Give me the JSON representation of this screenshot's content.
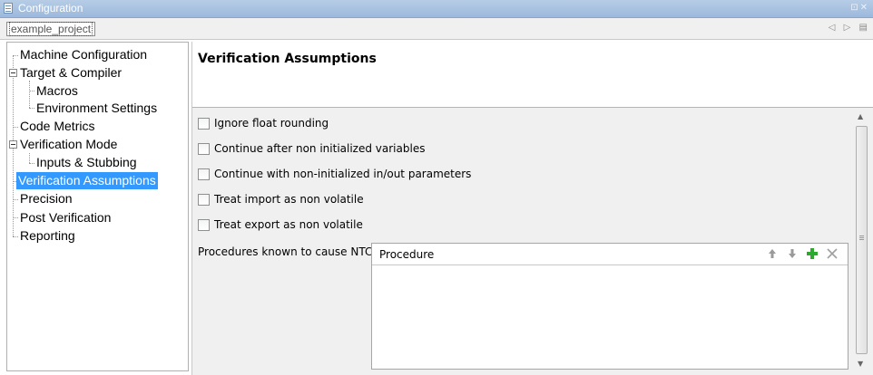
{
  "window": {
    "title": "Configuration",
    "controls": "⊡✕"
  },
  "project": {
    "name": "example_project",
    "nav_prev": "◁",
    "nav_next": "▷",
    "nav_list": "▤"
  },
  "tree": {
    "items": [
      {
        "label": "Machine Configuration"
      },
      {
        "label": "Target & Compiler"
      },
      {
        "label": "Macros"
      },
      {
        "label": "Environment Settings"
      },
      {
        "label": "Code Metrics"
      },
      {
        "label": "Verification Mode"
      },
      {
        "label": "Inputs & Stubbing"
      },
      {
        "label": "Verification Assumptions",
        "selected": true
      },
      {
        "label": "Precision"
      },
      {
        "label": "Post Verification"
      },
      {
        "label": "Reporting"
      }
    ]
  },
  "main": {
    "title": "Verification Assumptions",
    "options": [
      {
        "label": "Ignore float rounding",
        "checked": false
      },
      {
        "label": "Continue after non initialized variables",
        "checked": false
      },
      {
        "label": "Continue with non-initialized in/out parameters",
        "checked": false
      },
      {
        "label": "Treat import as non volatile",
        "checked": false
      },
      {
        "label": "Treat export as non volatile",
        "checked": false
      }
    ],
    "ntc_label": "Procedures known to cause NTC",
    "table": {
      "column": "Procedure",
      "rows": []
    }
  },
  "colors": {
    "selection": "#3399ff",
    "add_button": "#2fa82f",
    "titlebar": "#9bb8dc"
  }
}
